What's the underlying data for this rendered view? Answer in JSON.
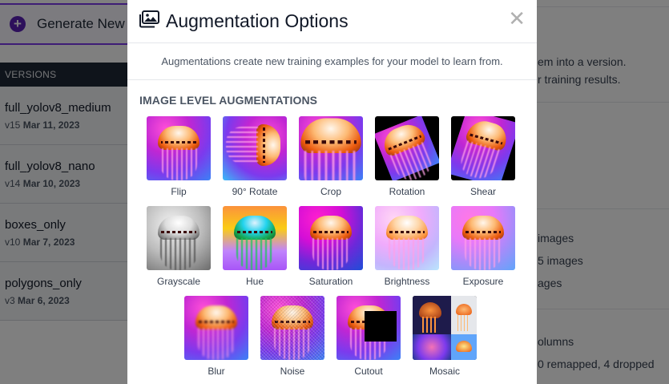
{
  "background": {
    "generate_label": "Generate New",
    "versions_heading": "VERSIONS",
    "versions": [
      {
        "name": "full_yolov8_medium",
        "version": "v15",
        "date": "Mar 11, 2023"
      },
      {
        "name": "full_yolov8_nano",
        "version": "v14",
        "date": "Mar 10, 2023"
      },
      {
        "name": "boxes_only",
        "version": "v10",
        "date": "Mar 7, 2023"
      },
      {
        "name": "polygons_only",
        "version": "v3",
        "date": "Mar 6, 2023"
      }
    ],
    "right_pane": {
      "line1": "em into a version.",
      "line2": "r training results.",
      "line3": "images",
      "line4": "5 images",
      "line5": "ages",
      "line6": "olumns",
      "line7": "0 remapped, 4 dropped"
    }
  },
  "modal": {
    "title": "Augmentation Options",
    "close_glyph": "✕",
    "subtitle": "Augmentations create new training examples for your model to learn from.",
    "section_title": "IMAGE LEVEL AUGMENTATIONS",
    "rows": [
      [
        {
          "label": "Flip",
          "style": "flip"
        },
        {
          "label": "90° Rotate",
          "style": "rot90"
        },
        {
          "label": "Crop",
          "style": "crop"
        },
        {
          "label": "Rotation",
          "style": "rotation"
        },
        {
          "label": "Shear",
          "style": "shear"
        }
      ],
      [
        {
          "label": "Grayscale",
          "style": "gray"
        },
        {
          "label": "Hue",
          "style": "hue"
        },
        {
          "label": "Saturation",
          "style": "sat"
        },
        {
          "label": "Brightness",
          "style": "bright"
        },
        {
          "label": "Exposure",
          "style": "expo"
        }
      ],
      [
        {
          "label": "Blur",
          "style": "blur"
        },
        {
          "label": "Noise",
          "style": "noise"
        },
        {
          "label": "Cutout",
          "style": "cutout"
        },
        {
          "label": "Mosaic",
          "style": "mosaic"
        }
      ]
    ]
  },
  "colors": {
    "accent": "#7c3aed",
    "overlay": "rgba(0,0,0,0.5)"
  }
}
